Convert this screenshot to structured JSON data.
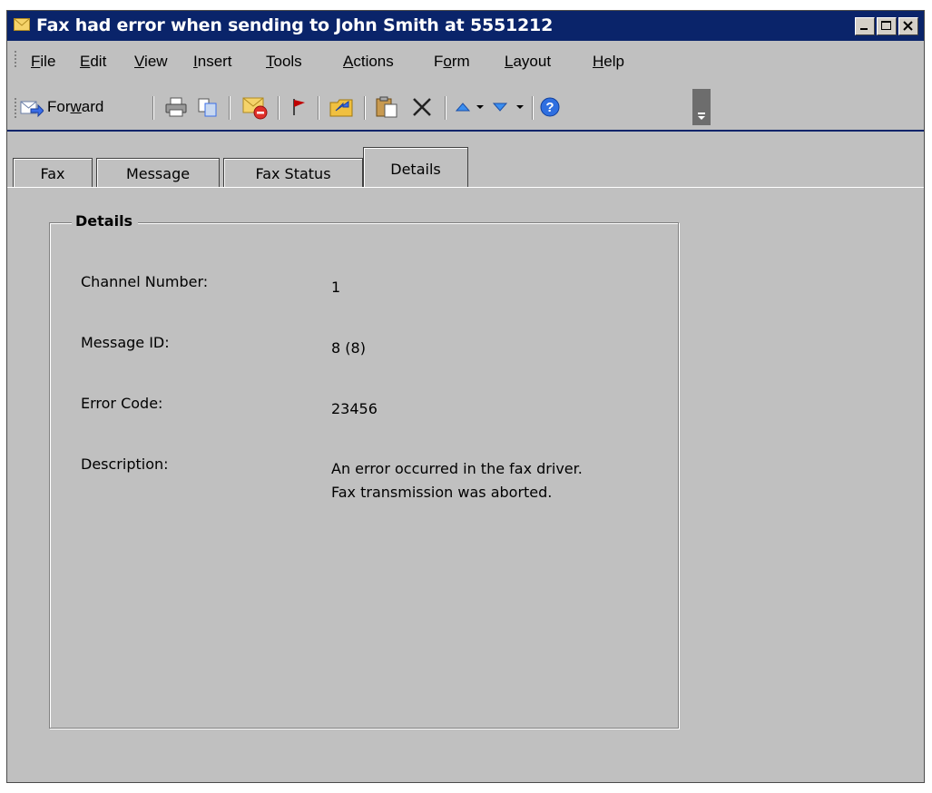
{
  "window": {
    "title": "Fax had error when sending to John Smith at 5551212",
    "icon": "envelope-icon",
    "caption_buttons": [
      "minimize-icon",
      "maximize-icon",
      "close-icon"
    ]
  },
  "menubar": {
    "items": [
      {
        "label": "File",
        "accel": "F",
        "rest": "ile"
      },
      {
        "label": "Edit",
        "accel": "E",
        "rest": "dit"
      },
      {
        "label": "View",
        "accel": "V",
        "rest": "iew"
      },
      {
        "label": "Insert",
        "accel": "I",
        "rest": "nsert"
      },
      {
        "label": "Tools",
        "accel": "T",
        "rest": "ools"
      },
      {
        "label": "Actions",
        "accel": "A",
        "rest": "ctions"
      },
      {
        "label": "Form",
        "pre": "F",
        "accel": "o",
        "rest": "rm"
      },
      {
        "label": "Layout",
        "accel": "L",
        "rest": "ayout"
      },
      {
        "label": "Help",
        "accel": "H",
        "rest": "elp"
      }
    ]
  },
  "toolbar": {
    "forward_label_pre": "For",
    "forward_label_accel": "w",
    "forward_label_post": "ard",
    "icons": [
      "forward-icon",
      "print-icon",
      "copy-icon",
      "reject-icon",
      "flag-icon",
      "move-to-folder-icon",
      "paste-icon",
      "delete-icon",
      "previous-item-icon",
      "next-item-icon",
      "help-icon",
      "toolbar-options-icon"
    ]
  },
  "tabs": [
    {
      "label": "Fax",
      "active": false
    },
    {
      "label": "Message",
      "active": false
    },
    {
      "label": "Fax Status",
      "active": false
    },
    {
      "label": "Details",
      "active": true
    }
  ],
  "details": {
    "group_title": "Details",
    "fields": [
      {
        "label": "Channel Number:",
        "value": "1"
      },
      {
        "label": "Message ID:",
        "value": "8 (8)"
      },
      {
        "label": "Error Code:",
        "value": "23456"
      },
      {
        "label": "Description:",
        "value_line1": "An error occurred in the fax driver.",
        "value_line2": "Fax transmission was aborted."
      }
    ]
  },
  "colors": {
    "titlebar": "#0a246a",
    "face": "#c0c0c0",
    "accent_blue": "#3a6ee8",
    "flag_red": "#c00000"
  }
}
